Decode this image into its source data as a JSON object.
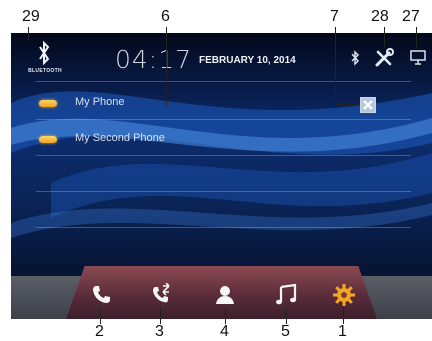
{
  "callouts": {
    "bluetooth_icon": "29",
    "device_list": "6",
    "delete_button": "7",
    "settings_icon": "28",
    "display_icon": "27",
    "phone": "2",
    "call_log": "3",
    "contacts": "4",
    "music": "5",
    "settings_gear": "1"
  },
  "status_bar": {
    "bluetooth_label": "BLUETOOTH",
    "time": "04:17",
    "date": "FEBRUARY 10, 2014"
  },
  "devices": [
    {
      "label": "My Phone"
    },
    {
      "label": "My Second Phone"
    }
  ],
  "icons": {
    "bluetooth": "bluetooth-icon",
    "tools": "tools-icon",
    "display": "monitor-icon",
    "delete": "close-icon",
    "phone": "phone-icon",
    "call_log": "call-log-icon",
    "contacts": "contact-icon",
    "music": "music-note-icon",
    "settings": "gear-icon"
  },
  "colors": {
    "accent": "#f2a51e",
    "background": "#06122b",
    "dock": "#6e3a45"
  }
}
